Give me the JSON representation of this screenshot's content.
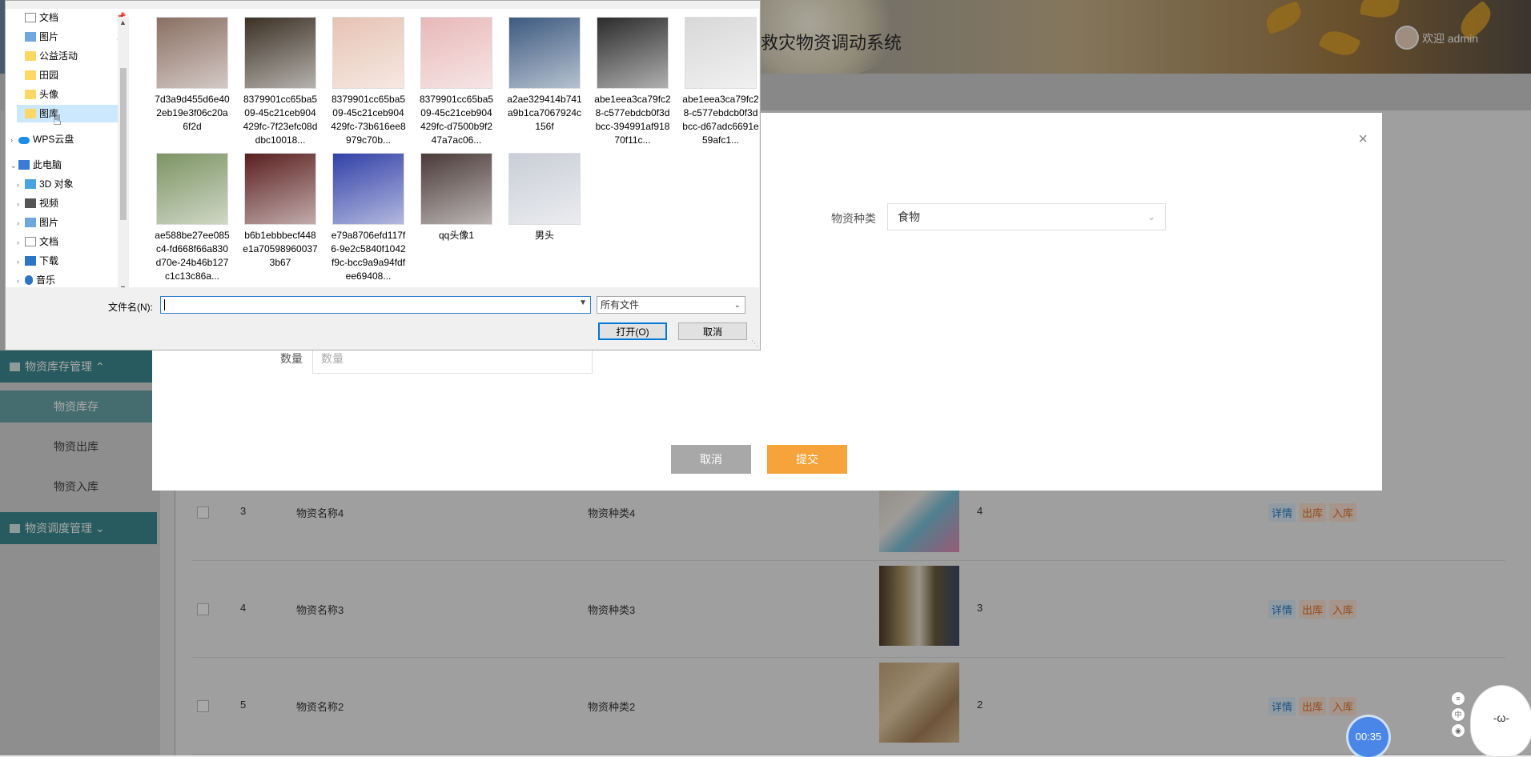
{
  "app": {
    "title": "救灾物资调动系统",
    "welcome": "欢迎 admin"
  },
  "sidebar": {
    "group_stock": "物资库存管理 ⌃",
    "group_dispatch": "物资调度管理 ⌄",
    "items": [
      {
        "label": "物资库存",
        "active": true
      },
      {
        "label": "物资出库",
        "active": false
      },
      {
        "label": "物资入库",
        "active": false
      }
    ]
  },
  "table": {
    "rows": [
      {
        "index": "3",
        "name": "物资名称4",
        "type": "物资种类4",
        "qty": "4"
      },
      {
        "index": "4",
        "name": "物资名称3",
        "type": "物资种类3",
        "qty": "3"
      },
      {
        "index": "5",
        "name": "物资名称2",
        "type": "物资种类2",
        "qty": "2"
      }
    ],
    "op_detail": "详情",
    "op_out": "出库",
    "op_in": "入库"
  },
  "modal": {
    "close": "×",
    "category_label": "物资种类",
    "category_value": "食物",
    "qty_label": "数量",
    "qty_placeholder": "数量",
    "cancel": "取消",
    "submit": "提交"
  },
  "dialog": {
    "nav": [
      {
        "label": "文档",
        "icon": "doc-icon",
        "pinned": true
      },
      {
        "label": "图片",
        "icon": "picture-icon",
        "pinned": true
      },
      {
        "label": "公益活动",
        "icon": "folder-icon"
      },
      {
        "label": "田园",
        "icon": "folder-icon"
      },
      {
        "label": "头像",
        "icon": "folder-icon"
      },
      {
        "label": "图库",
        "icon": "folder-icon",
        "selected": true
      },
      {
        "label": "WPS云盘",
        "icon": "cloud-icon"
      },
      {
        "label": "此电脑",
        "icon": "computer-icon"
      },
      {
        "label": "3D 对象",
        "icon": "3d-objects-icon"
      },
      {
        "label": "视频",
        "icon": "video-icon"
      },
      {
        "label": "图片",
        "icon": "picture-icon"
      },
      {
        "label": "文档",
        "icon": "doc-icon"
      },
      {
        "label": "下载",
        "icon": "download-icon"
      },
      {
        "label": "音乐",
        "icon": "music-icon"
      }
    ],
    "files": [
      {
        "name": "7d3a9d455d6e402eb19e3f06c20a6f2d",
        "color": "#8a6f63"
      },
      {
        "name": "8379901cc65ba509-45c21ceb904429fc-7f23efc08ddbc10018...",
        "color": "#3b3024"
      },
      {
        "name": "8379901cc65ba509-45c21ceb904429fc-73b616ee8979c70b...",
        "color": "#e6c3b3"
      },
      {
        "name": "8379901cc65ba509-45c21ceb904429fc-d7500b9f247a7ac06...",
        "color": "#e8b8b8"
      },
      {
        "name": "a2ae329414b741a9b1ca7067924c156f",
        "color": "#3d5a80"
      },
      {
        "name": "abe1eea3ca79fc28-c577ebdcb0f3dbcc-394991af91870f11c...",
        "color": "#2b2b2b"
      },
      {
        "name": "abe1eea3ca79fc28-c577ebdcb0f3dbcc-d67adc6691e59afc1...",
        "color": "#d8d8d8"
      },
      {
        "name": "ae588be27ee085c4-fd668f66a830d70e-24b46b127c1c13c86a...",
        "color": "#7d9464"
      },
      {
        "name": "b6b1ebbbecf448e1a705989600373b67",
        "color": "#5a1f1f"
      },
      {
        "name": "e79a8706efd117f6-9e2c5840f1042f9c-bcc9a9a94fdfee69408...",
        "color": "#3241a8"
      },
      {
        "name": "qq头像1",
        "color": "#4a3a38"
      },
      {
        "name": "男头",
        "color": "#c9cdd6"
      }
    ],
    "filename_label": "文件名(N):",
    "filename_value": "",
    "filetype": "所有文件",
    "open": "打开(O)",
    "cancel": "取消"
  },
  "widgets": {
    "timer": "00:35",
    "mascot": "-ω-"
  }
}
